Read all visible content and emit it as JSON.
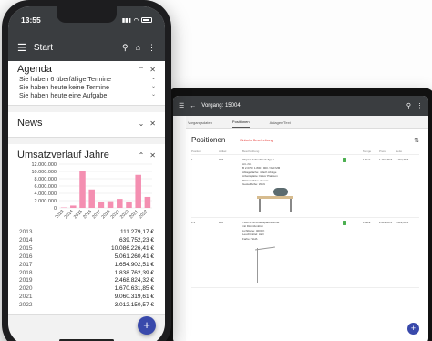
{
  "phone": {
    "status": {
      "time": "13:55"
    },
    "appbar": {
      "title": "Start"
    },
    "agenda": {
      "title": "Agenda",
      "items": [
        "Sie haben 6 überfällige Termine",
        "Sie haben heute keine Termine",
        "Sie haben heute eine Aufgabe"
      ]
    },
    "news": {
      "title": "News"
    },
    "revenue": {
      "title": "Umsatzverlauf Jahre",
      "rows": [
        {
          "year": "2013",
          "amount": "111.279,17 €"
        },
        {
          "year": "2014",
          "amount": "639.752,23 €"
        },
        {
          "year": "2015",
          "amount": "10.086.226,41 €"
        },
        {
          "year": "2016",
          "amount": "5.061.260,41 €"
        },
        {
          "year": "2017",
          "amount": "1.654.902,51 €"
        },
        {
          "year": "2018",
          "amount": "1.838.762,39 €"
        },
        {
          "year": "2019",
          "amount": "2.468.824,32 €"
        },
        {
          "year": "2020",
          "amount": "1.670.631,85 €"
        },
        {
          "year": "2021",
          "amount": "9.060.319,61 €"
        },
        {
          "year": "2022",
          "amount": "3.012.150,57 €"
        }
      ]
    }
  },
  "chart_data": {
    "type": "bar",
    "title": "Umsatzverlauf Jahre",
    "categories": [
      "2013",
      "2014",
      "2015",
      "2016",
      "2017",
      "2018",
      "2019",
      "2020",
      "2021",
      "2022"
    ],
    "values": [
      111279.17,
      639752.23,
      10086226.41,
      5061260.41,
      1654902.51,
      1838762.39,
      2468824.32,
      1670631.85,
      9060319.61,
      3012150.57
    ],
    "yticks": [
      "0",
      "2.000.000",
      "4.000.000",
      "6.000.000",
      "8.000.000",
      "10.000.000",
      "12.000.000"
    ],
    "ylim": [
      0,
      12000000
    ],
    "bar_color": "#f48fb1",
    "grid": true
  },
  "tablet": {
    "title": "Vorgang: 15004",
    "tabs": [
      "Vorgangsdaten",
      "Positionen",
      "Anlagen/Text"
    ],
    "heading": "Positionen",
    "subheading": "Einfache Beschreibung",
    "columns": [
      "Position",
      "Artikel",
      "Beschreibung",
      "",
      "Menge",
      "Preis",
      "Netto"
    ],
    "rows": [
      {
        "pos": "1",
        "artikel": "###",
        "desc": [
          "Objekt: Schreibtisch Typ A",
          "Art.-Nr.",
          "B 2.070 / 1.800 / 900 / 620 MM",
          "Ablagefläche: 4-fach Ablage",
          "Arbeitsplatte: Dekor Platinum",
          "Plattenstärke: 25 mm",
          "Gestellfarbe: Weiß"
        ],
        "qty": "1 Stck",
        "price": "1.162,79 €",
        "net": "1.162,79 €"
      },
      {
        "pos": "1.1",
        "artikel": "###",
        "desc": [
          "Tisch-LED-Arbeitsplatzleuchte",
          "mit Dimmfunktion",
          "Lichtfarbe: 4000 K",
          "Leuchtmittel: LED",
          "Farbe: Weiß"
        ],
        "qty": "1 Stck",
        "price": "2.622,00 €",
        "net": "2.622,00 €"
      }
    ]
  }
}
